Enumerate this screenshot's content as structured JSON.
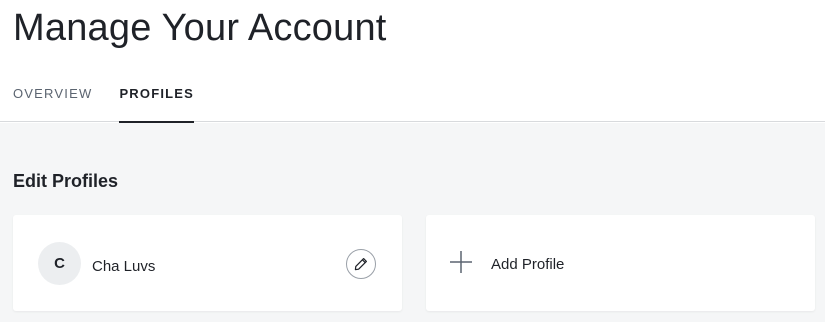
{
  "page": {
    "title": "Manage Your Account"
  },
  "tabs": [
    {
      "label": "OVERVIEW",
      "active": false
    },
    {
      "label": "PROFILES",
      "active": true
    }
  ],
  "section": {
    "title": "Edit Profiles"
  },
  "profiles": [
    {
      "initial": "C",
      "name": "Cha Luvs",
      "edit_icon": "pencil-icon"
    }
  ],
  "add_profile": {
    "label": "Add Profile",
    "icon": "plus-icon"
  },
  "colors": {
    "text": "#1f2228",
    "muted_tab": "#5b6470",
    "background": "#f5f6f7",
    "card": "#ffffff",
    "avatar": "#eceef0"
  }
}
